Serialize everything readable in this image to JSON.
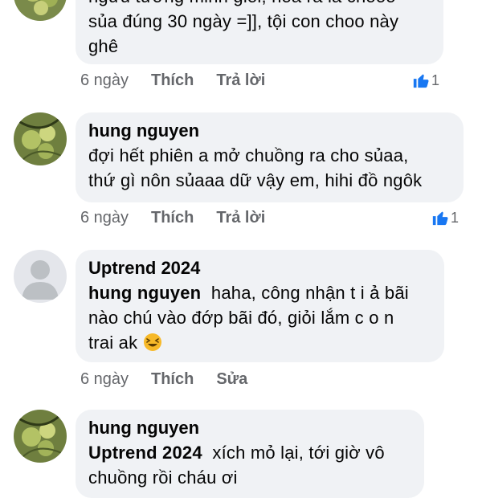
{
  "comments": [
    {
      "author": "",
      "lines": [
        "ngửu tướng minh giỏi, hoá ra là chooo",
        "sủa đúng 30 ngày =]], tội con choo này",
        "ghê"
      ],
      "time": "6 ngày",
      "actions": [
        "Thích",
        "Trả lời"
      ],
      "like_count": "1"
    },
    {
      "author": "hung nguyen",
      "lines": [
        "đợi hết phiên a mở chuồng ra cho sủaa,",
        "thứ gì nôn sủaaa dữ vậy em, hihi đồ ngôk"
      ],
      "time": "6 ngày",
      "actions": [
        "Thích",
        "Trả lời"
      ],
      "like_count": "1"
    },
    {
      "author": "Uptrend 2024",
      "mention": "hung nguyen",
      "lines": [
        "haha, công nhận t i ả bãi",
        "nào chú vào đớp bãi đó, giỏi lắm c o n",
        "trai ak"
      ],
      "emoji": "laughing-emoji",
      "time": "6 ngày",
      "actions": [
        "Thích",
        "Sửa"
      ]
    },
    {
      "author": "hung nguyen",
      "mention": "Uptrend 2024",
      "lines": [
        "xích mỏ lại, tới giờ vô",
        "chuồng rồi cháu ơi"
      ]
    }
  ],
  "colors": {
    "bubble": "#f0f2f5",
    "meta": "#65676b",
    "like_blue": "#1877f2"
  }
}
